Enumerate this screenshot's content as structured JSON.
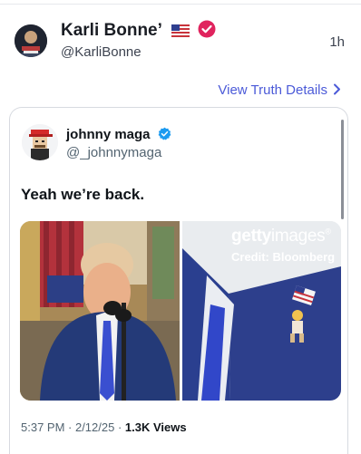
{
  "post": {
    "author_name": "Karli Bonne’",
    "author_handle": "@KarliBonne",
    "time": "1h",
    "flag_icon": "us-flag-icon",
    "verified_icon": "red-verified-badge-icon",
    "view_details_label": "View Truth Details",
    "accent_color": "#4b5ad8",
    "badge_color": "#e0245e"
  },
  "quote": {
    "author_name": "johnny maga",
    "author_handle": "@_johnnymaga",
    "verified_icon": "blue-verified-badge-icon",
    "text": "Yeah we’re back.",
    "media": {
      "watermark_brand_bold": "getty",
      "watermark_brand_rest": "images",
      "watermark_suffix": "®",
      "watermark_credit": "Credit: Bloomberg"
    },
    "meta": {
      "time": "5:37 PM · 2/12/25 ·",
      "views_count": "1.3K",
      "views_label": "Views"
    }
  }
}
